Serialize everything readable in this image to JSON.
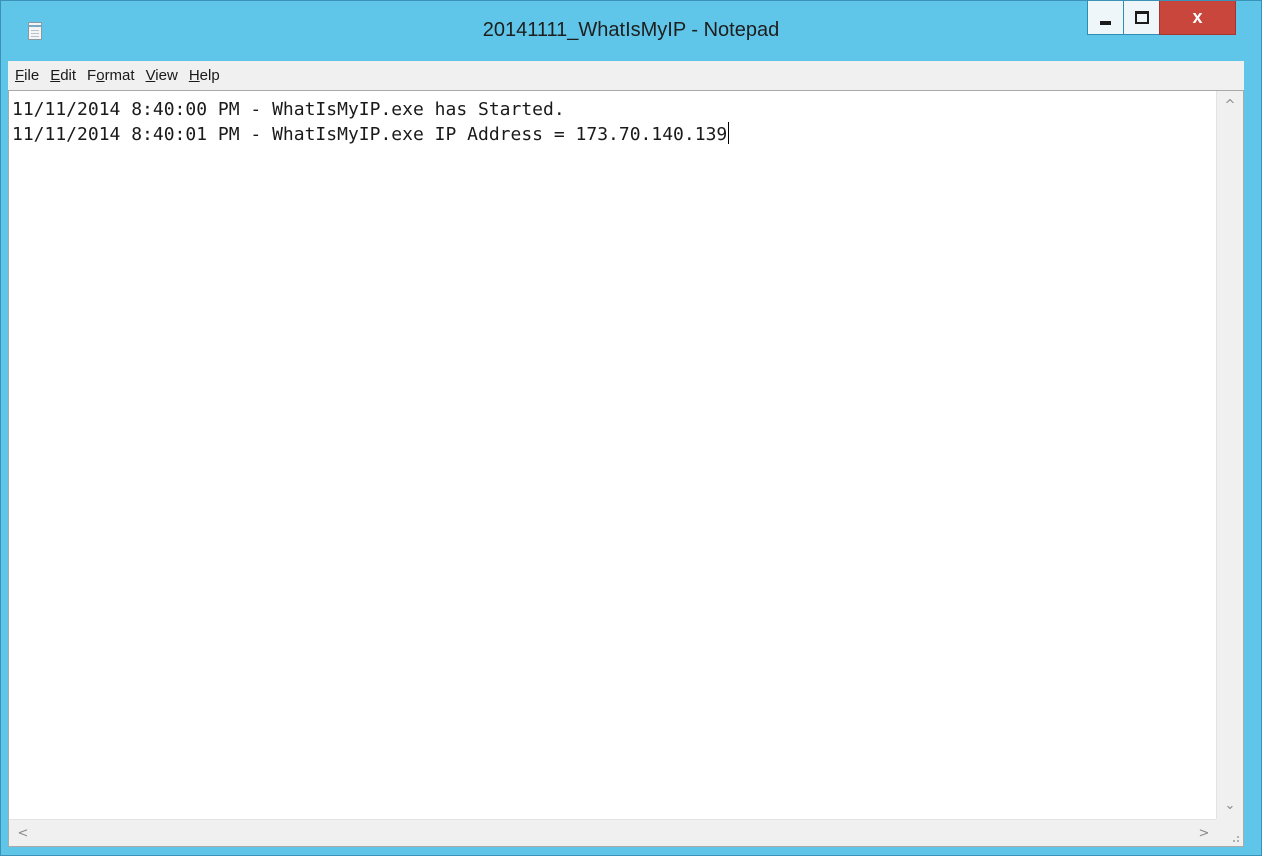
{
  "window": {
    "title": "20141111_WhatIsMyIP - Notepad",
    "close_label": "x"
  },
  "menu": {
    "items": [
      {
        "accel": "F",
        "rest": "ile"
      },
      {
        "accel": "E",
        "rest": "dit"
      },
      {
        "pre": "F",
        "accel": "o",
        "rest": "rmat"
      },
      {
        "accel": "V",
        "rest": "iew"
      },
      {
        "accel": "H",
        "rest": "elp"
      }
    ]
  },
  "document": {
    "lines": [
      "11/11/2014 8:40:00 PM - WhatIsMyIP.exe has Started.",
      "11/11/2014 8:40:01 PM - WhatIsMyIP.exe IP Address = 173.70.140.139"
    ]
  },
  "scrollbars": {
    "up_glyph": "^",
    "down_glyph": "⌄",
    "left_glyph": "<",
    "right_glyph": ">"
  },
  "colors": {
    "titlebar": "#5fc6e9",
    "close_button": "#c9463d",
    "menubar": "#f0f0f0"
  },
  "icons": [
    "notepad-app-icon",
    "minimize-icon",
    "maximize-icon",
    "close-icon",
    "scroll-up-icon",
    "scroll-down-icon",
    "scroll-left-icon",
    "scroll-right-icon",
    "size-grip-icon"
  ]
}
